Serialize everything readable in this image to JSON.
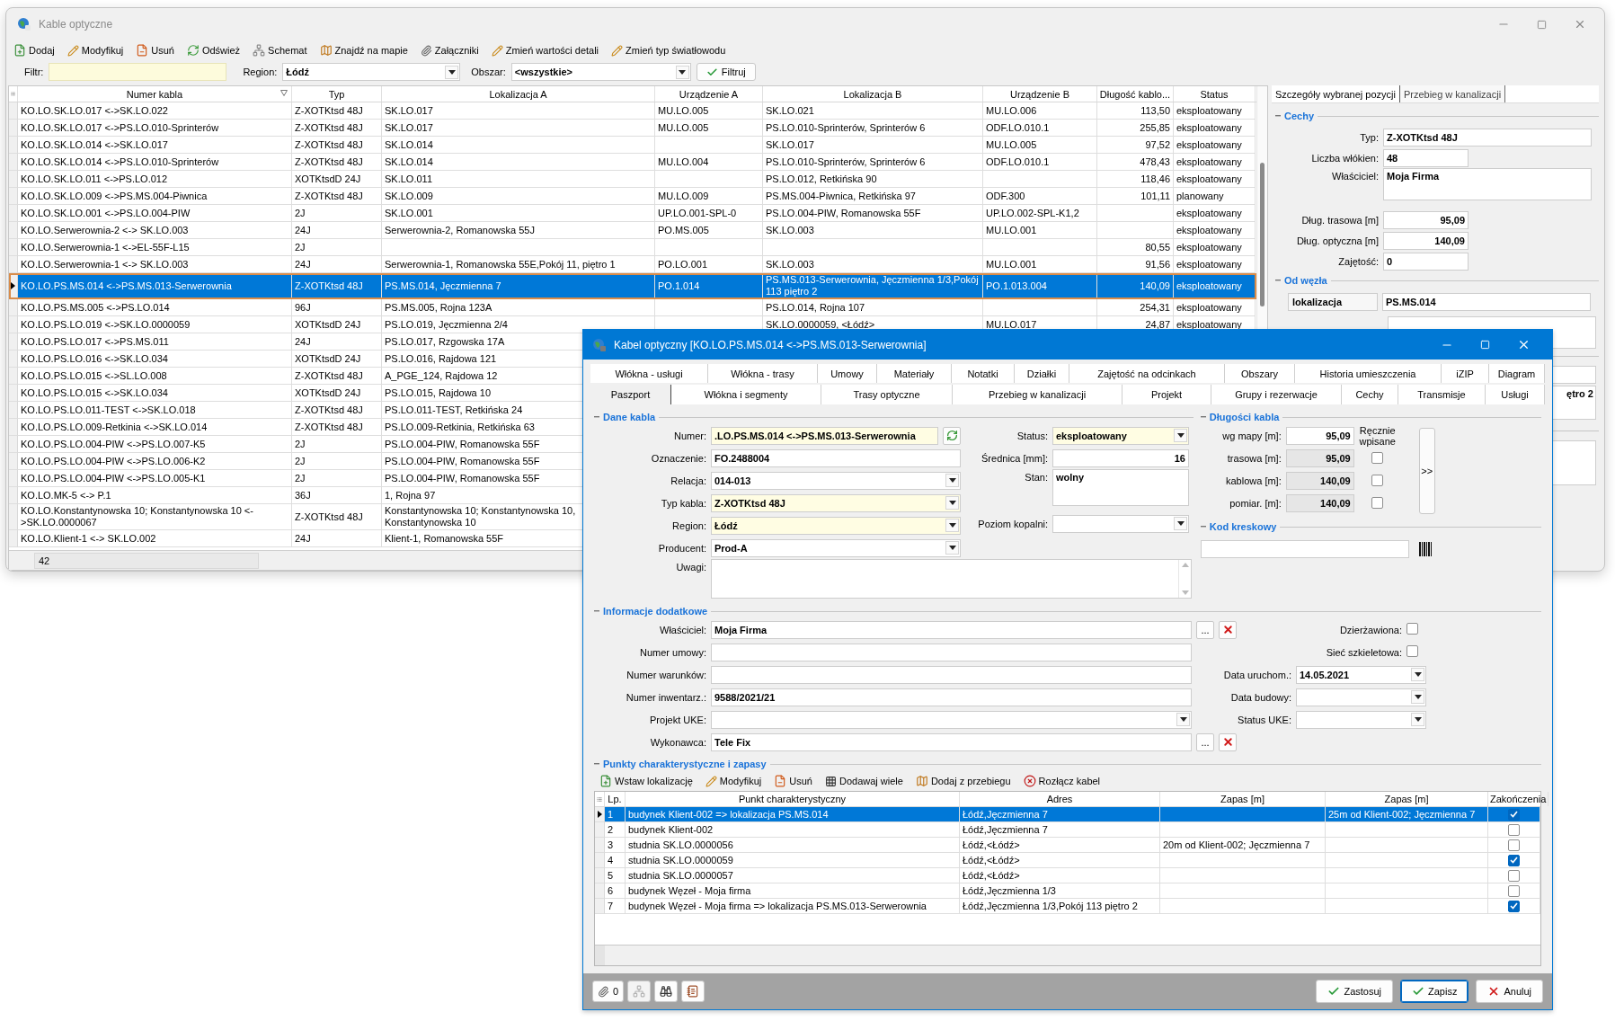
{
  "main_window": {
    "title": "Kable optyczne",
    "toolbar": [
      {
        "label": "Dodaj",
        "kind": "add"
      },
      {
        "label": "Modyfikuj",
        "kind": "edit"
      },
      {
        "label": "Usuń",
        "kind": "delete"
      },
      {
        "label": "Odśwież",
        "kind": "refresh"
      },
      {
        "label": "Schemat",
        "kind": "schema"
      },
      {
        "label": "Znajdź na mapie",
        "kind": "map"
      },
      {
        "label": "Załączniki",
        "kind": "attach"
      },
      {
        "label": "Zmień wartości detali",
        "kind": "edit"
      },
      {
        "label": "Zmień typ światłowodu",
        "kind": "edit"
      }
    ],
    "filter": {
      "label": "Filtr:"
    },
    "region": {
      "label": "Region:",
      "value": "Łódź"
    },
    "area": {
      "label": "Obszar:",
      "value": "<wszystkie>"
    },
    "filter_button": "Filtruj",
    "table": {
      "columns": [
        "Numer kabla",
        "Typ",
        "Lokalizacja A",
        "Urządzenie A",
        "Lokalizacja B",
        "Urządzenie B",
        "Długość kablo...",
        "Status"
      ],
      "rows": [
        {
          "number": "KO.LO.SK.LO.017 <->SK.LO.022",
          "type": "Z-XOTKtsd 48J",
          "location_a": "SK.LO.017",
          "device_a": "MU.LO.005",
          "location_b": "SK.LO.021",
          "device_b": "MU.LO.006",
          "length": "113,50",
          "status": "eksploatowany",
          "selected": false
        },
        {
          "number": "KO.LO.SK.LO.017 <->PS.LO.010-Sprinterów",
          "type": "Z-XOTKtsd 48J",
          "location_a": "SK.LO.017",
          "device_a": "MU.LO.005",
          "location_b": "PS.LO.010-Sprinterów, Sprinterów 6",
          "device_b": "ODF.LO.010.1",
          "length": "255,85",
          "status": "eksploatowany",
          "selected": false
        },
        {
          "number": "KO.LO.SK.LO.014 <->SK.LO.017",
          "type": "Z-XOTKtsd 48J",
          "location_a": "SK.LO.014",
          "location_b": "SK.LO.017",
          "device_b": "MU.LO.005",
          "length": "97,52",
          "status": "eksploatowany",
          "selected": false
        },
        {
          "number": "KO.LO.SK.LO.014 <->PS.LO.010-Sprinterów",
          "type": "Z-XOTKtsd 48J",
          "location_a": "SK.LO.014",
          "device_a": "MU.LO.004",
          "location_b": "PS.LO.010-Sprinterów, Sprinterów 6",
          "device_b": "ODF.LO.010.1",
          "length": "478,43",
          "status": "eksploatowany",
          "selected": false
        },
        {
          "number": "KO.LO.SK.LO.011 <->PS.LO.012",
          "type": "XOTKtsdD 24J",
          "location_a": "SK.LO.011",
          "location_b": "PS.LO.012, Retkińska 90",
          "length": "118,46",
          "status": "eksploatowany",
          "selected": false
        },
        {
          "number": "KO.LO.SK.LO.009 <->PS.MS.004-Piwnica",
          "type": "Z-XOTKtsd 48J",
          "location_a": "SK.LO.009",
          "device_a": "MU.LO.009",
          "location_b": "PS.MS.004-Piwnica, Retkińska 97",
          "device_b": "ODF.300",
          "length": "101,11",
          "status": "planowany",
          "selected": false
        },
        {
          "number": "KO.LO.SK.LO.001 <->PS.LO.004-PIW",
          "type": "2J",
          "location_a": "SK.LO.001",
          "device_a": "UP.LO.001-SPL-0",
          "location_b": "PS.LO.004-PIW, Romanowska 55F",
          "device_b": "UP.LO.002-SPL-K1,2",
          "status": "eksploatowany",
          "selected": false
        },
        {
          "number": "KO.LO.Serwerownia-2 <-> SK.LO.003",
          "type": "24J",
          "location_a": "Serwerownia-2, Romanowska 55J",
          "device_a": "PO.MS.005",
          "location_b": "SK.LO.003",
          "device_b": "MU.LO.001",
          "status": "eksploatowany",
          "selected": false
        },
        {
          "number": "KO.LO.Serwerownia-1 <->EL-55F-L15",
          "type": "2J",
          "length": "80,55",
          "status": "eksploatowany",
          "selected": false
        },
        {
          "number": "KO.LO.Serwerownia-1 <-> SK.LO.003",
          "type": "24J",
          "location_a": "Serwerownia-1, Romanowska 55E,Pokój 11, piętro 1",
          "device_a": "PO.LO.001",
          "location_b": "SK.LO.003",
          "device_b": "MU.LO.001",
          "length": "91,56",
          "status": "eksploatowany",
          "selected": false
        },
        {
          "number": "KO.LO.PS.MS.014 <->PS.MS.013-Serwerownia",
          "type": "Z-XOTKtsd 48J",
          "location_a": "PS.MS.014, Jęczmienna 7",
          "device_a": "PO.1.014",
          "location_b": "PS.MS.013-Serwerownia, Jęczmienna 1/3,Pokój 113 piętro 2",
          "device_b": "PO.1.013.004",
          "length": "140,09",
          "status": "eksploatowany",
          "selected": true
        },
        {
          "number": "KO.LO.PS.MS.005 <->PS.LO.014",
          "type": "96J",
          "location_a": "PS.MS.005, Rojna 123A",
          "location_b": "PS.LO.014, Rojna 107",
          "length": "254,31",
          "status": "eksploatowany",
          "selected": false
        },
        {
          "number": "KO.LO.PS.LO.019 <->SK.LO.0000059",
          "type": "XOTKtsdD 24J",
          "location_a": "PS.LO.019, Jęczmienna 2/4",
          "location_b": "SK.LO.0000059, <Łódź>",
          "device_b": "MU.LO.017",
          "length": "24,87",
          "status": "eksploatowany",
          "selected": false
        },
        {
          "number": "KO.LO.PS.LO.017 <->PS.MS.011",
          "type": "24J",
          "location_a": "PS.LO.017, Rzgowska 17A",
          "selected": false
        },
        {
          "number": "KO.LO.PS.LO.016 <->SK.LO.034",
          "type": "XOTKtsdD 24J",
          "location_a": "PS.LO.016, Rajdowa 121",
          "selected": false
        },
        {
          "number": "KO.LO.PS.LO.015 <->SL.LO.008",
          "type": "Z-XOTKtsd 48J",
          "location_a": "A_PGE_124, Rajdowa 12",
          "selected": false
        },
        {
          "number": "KO.LO.PS.LO.015 <->SK.LO.034",
          "type": "XOTKtsdD 24J",
          "location_a": "PS.LO.015, Rajdowa 10",
          "selected": false
        },
        {
          "number": "KO.LO.PS.LO.011-TEST <->SK.LO.018",
          "type": "Z-XOTKtsd 48J",
          "location_a": "PS.LO.011-TEST, Retkińska 24",
          "selected": false
        },
        {
          "number": "KO.LO.PS.LO.009-Retkinia <->SK.LO.014",
          "type": "Z-XOTKtsd 48J",
          "location_a": "PS.LO.009-Retkinia, Retkińska 63",
          "selected": false
        },
        {
          "number": "KO.LO.PS.LO.004-PIW <->PS.LO.007-K5",
          "type": "2J",
          "location_a": "PS.LO.004-PIW, Romanowska 55F",
          "selected": false
        },
        {
          "number": "KO.LO.PS.LO.004-PIW <->PS.LO.006-K2",
          "type": "2J",
          "location_a": "PS.LO.004-PIW, Romanowska 55F",
          "selected": false
        },
        {
          "number": "KO.LO.PS.LO.004-PIW <->PS.LO.005-K1",
          "type": "2J",
          "location_a": "PS.LO.004-PIW, Romanowska 55F",
          "selected": false
        },
        {
          "number": "KO.LO.MK-5 <-> P.1",
          "type": "36J",
          "location_a": "1, Rojna 97",
          "selected": false
        },
        {
          "number": "KO.LO.Konstantynowska 10; Konstantynowska 10 <->SK.LO.0000067",
          "type": "Z-XOTKtsd 48J",
          "location_a": "Konstantynowska 10; Konstantynowska 10, Konstantynowska 10",
          "selected": false
        },
        {
          "number": "KO.LO.Klient-1 <-> SK.LO.002",
          "type": "24J",
          "location_a": "Klient-1, Romanowska 55F",
          "selected": false
        }
      ],
      "record_count": "42"
    },
    "details": {
      "tabs": [
        {
          "label": "Szczegóły wybranej pozycji",
          "selected": true
        },
        {
          "label": "Przebieg w kanalizacji",
          "selected": false
        }
      ],
      "features": {
        "title": "Cechy",
        "fields": [
          {
            "label": "Typ:",
            "value": "Z-XOTKtsd 48J",
            "kind": "wide"
          },
          {
            "label": "Liczba włókien:",
            "value": "48",
            "kind": "short"
          },
          {
            "label": "Właściciel:",
            "value": "Moja Firma",
            "kind": "memo"
          },
          {
            "label": "Dług. trasowa [m]",
            "value": "95,09",
            "kind": "number"
          },
          {
            "label": "Dług. optyczna [m]",
            "value": "140,09",
            "kind": "number"
          },
          {
            "label": "Zajętość:",
            "value": "0",
            "kind": "short"
          }
        ]
      },
      "node": {
        "title": "Od węzła",
        "label": "lokalizacja",
        "value": "PS.MS.014"
      },
      "cut_value": "ętro 2"
    }
  },
  "dialog": {
    "title": "Kabel optyczny [KO.LO.PS.MS.014 <->PS.MS.013-Serwerownia]",
    "tabs_top": [
      {
        "label": "Włókna - usługi",
        "selected": false
      },
      {
        "label": "Włókna - trasy",
        "selected": false
      },
      {
        "label": "Umowy",
        "selected": false
      },
      {
        "label": "Materiały",
        "selected": false
      },
      {
        "label": "Notatki",
        "selected": false
      },
      {
        "label": "Działki",
        "selected": false
      },
      {
        "label": "Zajętość na odcinkach",
        "selected": false
      },
      {
        "label": "Obszary",
        "selected": false
      },
      {
        "label": "Historia umieszczenia",
        "selected": false
      },
      {
        "label": "iZIP",
        "selected": false
      },
      {
        "label": "Diagram",
        "selected": false
      }
    ],
    "tabs_bottom": [
      {
        "label": "Paszport",
        "selected": true
      },
      {
        "label": "Włókna i segmenty",
        "selected": false
      },
      {
        "label": "Trasy optyczne",
        "selected": false
      },
      {
        "label": "Przebieg w kanalizacji",
        "selected": false
      },
      {
        "label": "Projekt",
        "selected": false
      },
      {
        "label": "Grupy i rezerwacje",
        "selected": false
      },
      {
        "label": "Cechy",
        "selected": false
      },
      {
        "label": "Transmisje",
        "selected": false
      },
      {
        "label": "Usługi",
        "selected": false
      }
    ],
    "cable": {
      "title": "Dane kabla",
      "left_fields": [
        {
          "label": "Numer:",
          "value": ".LO.PS.MS.014 <->PS.MS.013-Serwerownia",
          "kind": "refresh",
          "highlight": true
        },
        {
          "label": "Oznaczenie:",
          "value": "FO.2488004",
          "kind": "text",
          "highlight": false
        },
        {
          "label": "Relacja:",
          "value": "014-013",
          "kind": "combo",
          "highlight": false
        },
        {
          "label": "Typ kabla:",
          "value": "Z-XOTKtsd 48J",
          "kind": "combo",
          "highlight": true
        },
        {
          "label": "Region:",
          "value": "Łódź",
          "kind": "combo",
          "highlight": true
        },
        {
          "label": "Producent:",
          "value": "Prod-A",
          "kind": "combo",
          "highlight": false
        }
      ],
      "mid_fields": [
        {
          "label": "Status:",
          "value": "eksploatowany",
          "kind": "combo",
          "highlight": true
        },
        {
          "label": "Średnica [mm]:",
          "value": "16",
          "kind": "number",
          "highlight": false
        },
        {
          "label": "Stan:",
          "value": "wolny",
          "kind": "memo",
          "highlight": false
        },
        {
          "label": "Poziom kopalni:",
          "kind": "combo",
          "highlight": false
        }
      ],
      "notes": {
        "label": "Uwagi:"
      }
    },
    "lengths": {
      "title": "Długości kabla",
      "manual_header": "Ręcznie wpisane",
      "expand_button": ">>",
      "rows": [
        {
          "label": "wg mapy [m]:",
          "value": "95,09",
          "editable": true
        },
        {
          "label": "trasowa [m]:",
          "value": "95,09",
          "editable": false,
          "checked": false
        },
        {
          "label": "kablowa [m]:",
          "value": "140,09",
          "editable": false,
          "checked": false
        },
        {
          "label": "pomiar. [m]:",
          "value": "140,09",
          "editable": false,
          "checked": false
        }
      ]
    },
    "barcode": {
      "title": "Kod kreskowy"
    },
    "extra": {
      "title": "Informacje dodatkowe",
      "left_fields": [
        {
          "label": "Właściciel:",
          "value": "Moja Firma",
          "kind": "picker",
          "button": "..."
        },
        {
          "label": "Numer umowy:",
          "kind": "text"
        },
        {
          "label": "Numer warunków:",
          "kind": "text"
        },
        {
          "label": "Numer inwentarz.:",
          "value": "9588/2021/21",
          "kind": "text"
        },
        {
          "label": "Projekt UKE:",
          "kind": "combo"
        },
        {
          "label": "Wykonawca:",
          "value": "Tele Fix",
          "kind": "picker",
          "button": "..."
        }
      ],
      "right_fields": [
        {
          "label": "Dzierżawiona:",
          "kind": "check",
          "checked": false
        },
        {
          "label": "Sieć szkieletowa:",
          "kind": "check",
          "checked": false
        },
        {
          "label": "Data uruchom.:",
          "value": "14.05.2021",
          "kind": "combo"
        },
        {
          "label": "Data budowy:",
          "kind": "combo"
        },
        {
          "label": "Status UKE:",
          "kind": "combo"
        }
      ]
    },
    "points": {
      "title": "Punkty charakterystyczne i zapasy",
      "toolbar": [
        {
          "label": "Wstaw lokalizację",
          "kind": "add"
        },
        {
          "label": "Modyfikuj",
          "kind": "edit"
        },
        {
          "label": "Usuń",
          "kind": "delete"
        },
        {
          "label": "Dodawaj wiele",
          "kind": "grid"
        },
        {
          "label": "Dodaj z przebiegu",
          "kind": "map"
        },
        {
          "label": "Rozłącz kabel",
          "kind": "disconnect"
        }
      ],
      "columns": [
        "Lp.",
        "Punkt charakterystyczny",
        "Adres",
        "Zapas [m]",
        "Zapas [m]",
        "Zakończenia"
      ],
      "rows": [
        {
          "lp": "1",
          "point": "budynek Klient-002 => lokalizacja PS.MS.014",
          "address": "Łódź,Jęczmienna 7",
          "reserve_2": "25m od Klient-002; Jęczmienna 7",
          "checked": true,
          "selected": true
        },
        {
          "lp": "2",
          "point": "budynek Klient-002",
          "address": "Łódź,Jęczmienna 7",
          "checked": false,
          "selected": false
        },
        {
          "lp": "3",
          "point": "studnia SK.LO.0000056",
          "address": "Łódź,<Łódź>",
          "reserve_1": "20m od Klient-002; Jęczmienna 7",
          "checked": false,
          "selected": false
        },
        {
          "lp": "4",
          "point": "studnia SK.LO.0000059",
          "address": "Łódź,<Łódź>",
          "checked": true,
          "selected": false
        },
        {
          "lp": "5",
          "point": "studnia SK.LO.0000057",
          "address": "Łódź,<Łódź>",
          "checked": false,
          "selected": false
        },
        {
          "lp": "6",
          "point": "budynek Węzeł - Moja firma",
          "address": "Łódź,Jęczmienna 1/3",
          "checked": false,
          "selected": false
        },
        {
          "lp": "7",
          "point": "budynek Węzeł - Moja firma => lokalizacja PS.MS.013-Serwerownia",
          "address": "Łódź,Jęczmienna 1/3,Pokój 113 piętro 2",
          "checked": true,
          "selected": false
        }
      ]
    },
    "footer": {
      "tools": [
        {
          "kind": "attach",
          "label": "0",
          "disabled": false
        },
        {
          "kind": "schema",
          "disabled": true
        },
        {
          "kind": "search",
          "disabled": false
        },
        {
          "kind": "notes",
          "disabled": false
        }
      ],
      "buttons": [
        {
          "label": "Zastosuj",
          "kind": "apply",
          "focused": false
        },
        {
          "label": "Zapisz",
          "kind": "save",
          "focused": true
        },
        {
          "label": "Anuluj",
          "kind": "cancel",
          "focused": false
        }
      ]
    }
  }
}
